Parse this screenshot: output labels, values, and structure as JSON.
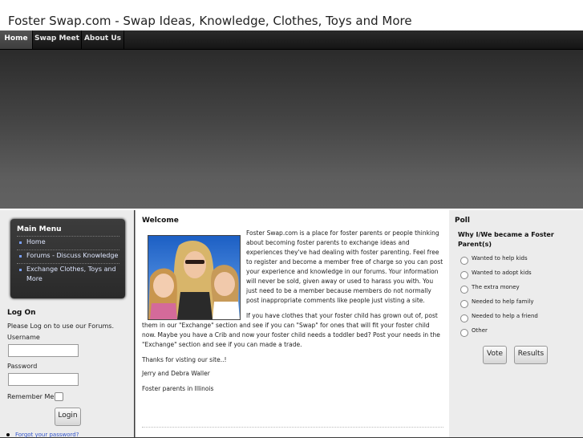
{
  "header": {
    "title": "Foster Swap.com - Swap Ideas, Knowledge, Clothes, Toys and More"
  },
  "nav": {
    "items": [
      "Home",
      "Swap Meet",
      "About Us"
    ],
    "active": "Home"
  },
  "main_menu": {
    "title": "Main Menu",
    "items": [
      "Home",
      "Forums - Discuss Knowledge",
      "Exchange Clothes, Toys and More"
    ]
  },
  "login": {
    "title": "Log On",
    "note": "Please Log on to use our Forums.",
    "username_label": "Username",
    "username_value": "",
    "password_label": "Password",
    "password_value": "",
    "remember_label": "Remember Me",
    "remember_checked": false,
    "login_button": "Login",
    "forgot_link": "Forgot your password?"
  },
  "content": {
    "title": "Welcome",
    "paragraph1": "Foster Swap.com is a place for foster parents or people thinking about becoming foster parents to exchange ideas and experiences they've had dealing with foster parenting. Feel free to register and become a member free of charge so you can post your experience and knowledge in our forums. Your information will never be sold, given away or used to harass you with. You just need to be a member because members do not normally post inappropriate comments like people just visting a site.",
    "paragraph2": "If you have clothes that your foster child has grown out of, post them in our \"Exchange\" section and see if you can \"Swap\" for ones that will fit your foster child now. Maybe you have a Crib and now your foster child needs a toddler bed? Post your needs in the \"Exchange\" section and see if you can made a trade.",
    "thanks": "Thanks for visting our site..!",
    "names": "Jerry and Debra Waller",
    "location": "Foster parents in Illinois"
  },
  "poll": {
    "title": "Poll",
    "question": "Why I/We became a Foster Parent(s)",
    "options": [
      "Wanted to help kids",
      "Wanted to adopt kids",
      "The extra money",
      "Needed to help family",
      "Needed to help a friend",
      "Other"
    ],
    "vote_button": "Vote",
    "results_button": "Results"
  },
  "colors": {
    "link": "#3355cc",
    "menu_bullet": "#7aa0ff",
    "nav_bg": "#1f1f1f"
  },
  "icons": {
    "menu_bullet": "square-bullet-icon",
    "forgot_bullet": "dot-bullet-icon"
  }
}
